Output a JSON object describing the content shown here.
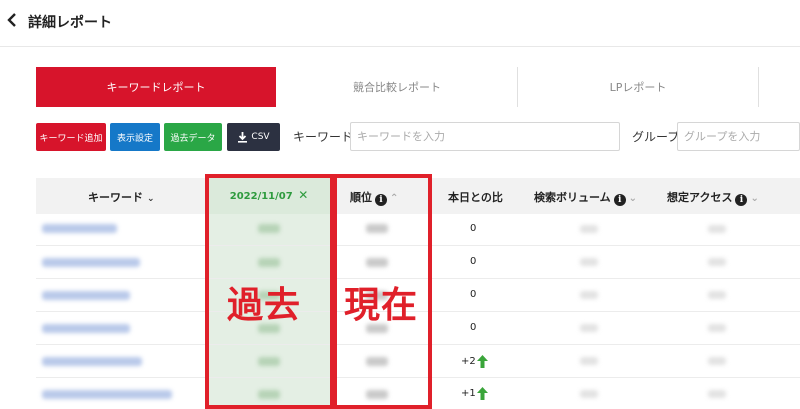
{
  "header": {
    "title": "詳細レポート"
  },
  "tabs": [
    {
      "label": "キーワードレポート",
      "active": true
    },
    {
      "label": "競合比較レポート",
      "active": false
    },
    {
      "label": "LPレポート",
      "active": false
    }
  ],
  "toolbar": {
    "add_keyword": "キーワード追加",
    "display_settings": "表示設定",
    "past_data": "過去データ",
    "csv": "CSV",
    "keyword_label": "キーワード",
    "keyword_placeholder": "キーワードを入力",
    "group_label": "グループ",
    "group_placeholder": "グループを入力"
  },
  "colors": {
    "brand_red": "#d7142b",
    "add_button": "#d7142b",
    "display_button": "#1578c8",
    "past_button": "#2aa746",
    "csv_button": "#2c3141",
    "past_column": "#e4efe4",
    "annotation_red": "#e0202a",
    "up_arrow": "#3aa53a"
  },
  "table": {
    "headers": {
      "keyword": "キーワード",
      "past_date": "2022/11/07",
      "rank": "順位",
      "diff": "本日との比",
      "volume": "検索ボリューム",
      "access": "想定アクセス"
    },
    "diff_values": [
      "0",
      "0",
      "0",
      "0",
      "+2",
      "+1"
    ]
  },
  "annotations": {
    "past": "過去",
    "current": "現在"
  }
}
